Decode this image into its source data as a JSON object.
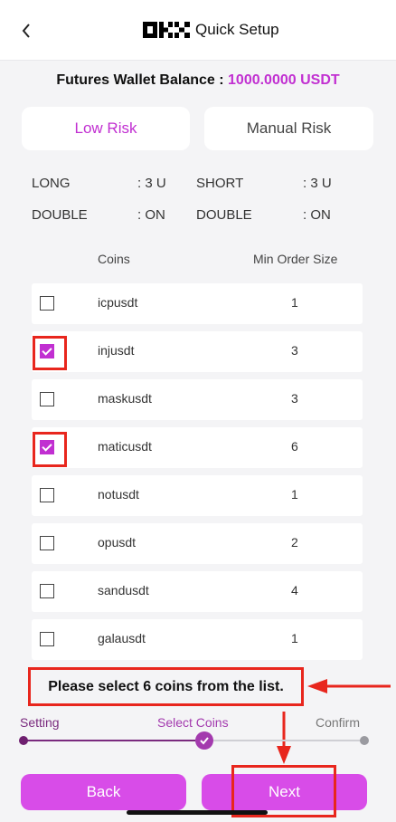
{
  "header": {
    "title": "Quick Setup",
    "logo_text": "OKX"
  },
  "balance": {
    "label": "Futures Wallet Balance : ",
    "value": "1000.0000 USDT"
  },
  "risk_tabs": {
    "low": "Low Risk",
    "manual": "Manual Risk",
    "selected": "Low Risk"
  },
  "params": {
    "long_label": "LONG",
    "long_value": ": 3 U",
    "short_label": "SHORT",
    "short_value": ": 3 U",
    "double_label_left": "DOUBLE",
    "double_value_left": ": ON",
    "double_label_right": "DOUBLE",
    "double_value_right": ": ON"
  },
  "table": {
    "col_coins": "Coins",
    "col_min": "Min Order Size",
    "rows": [
      {
        "coin": "icpusdt",
        "min": "1",
        "checked": false
      },
      {
        "coin": "injusdt",
        "min": "3",
        "checked": true
      },
      {
        "coin": "maskusdt",
        "min": "3",
        "checked": false
      },
      {
        "coin": "maticusdt",
        "min": "6",
        "checked": true
      },
      {
        "coin": "notusdt",
        "min": "1",
        "checked": false
      },
      {
        "coin": "opusdt",
        "min": "2",
        "checked": false
      },
      {
        "coin": "sandusdt",
        "min": "4",
        "checked": false
      },
      {
        "coin": "galausdt",
        "min": "1",
        "checked": false
      }
    ]
  },
  "callout": "Please select 6 coins from the list.",
  "steps": {
    "items": [
      "Setting",
      "Select Coins",
      "Confirm"
    ],
    "current": 1
  },
  "buttons": {
    "back": "Back",
    "next": "Next"
  },
  "colors": {
    "accent": "#c12fd1",
    "button": "#d84ce8",
    "highlight_red": "#e8261d"
  },
  "icons": [
    "chevron-left-icon",
    "okx-logo",
    "checkmark-icon",
    "arrow-left-icon",
    "arrow-down-icon"
  ]
}
